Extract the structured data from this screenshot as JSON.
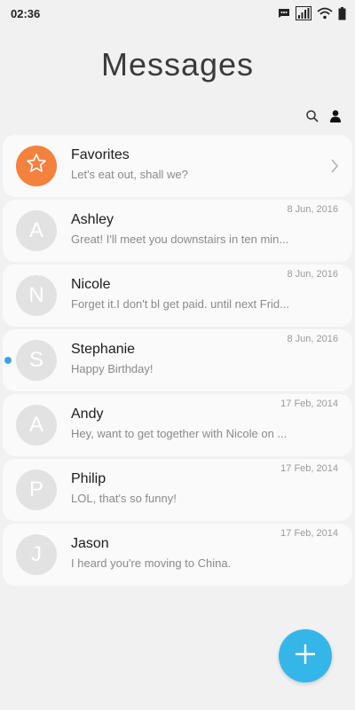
{
  "status_bar": {
    "time": "02:36",
    "icons": [
      "message-notification-icon",
      "signal-icon",
      "wifi-icon",
      "battery-icon"
    ]
  },
  "header": {
    "title": "Messages",
    "actions": [
      "search-icon",
      "contacts-icon"
    ]
  },
  "favorites": {
    "name": "Favorites",
    "snippet": "Let's eat out, shall we?",
    "icon": "star-icon",
    "accent": "#f5813f"
  },
  "threads": [
    {
      "initial": "A",
      "name": "Ashley",
      "snippet": "Great! I'll meet you downstairs in ten min...",
      "date": "8 Jun, 2016"
    },
    {
      "initial": "N",
      "name": "Nicole",
      "snippet": "Forget it.I don't bl get paid. until next Frid...",
      "date": "8 Jun, 2016"
    },
    {
      "initial": "S",
      "name": "Stephanie",
      "snippet": "Happy Birthday!",
      "date": "8 Jun, 2016",
      "unread": true
    },
    {
      "initial": "A",
      "name": "Andy",
      "snippet": "Hey, want to get together with Nicole on ...",
      "date": "17 Feb, 2014"
    },
    {
      "initial": "P",
      "name": "Philip",
      "snippet": "LOL, that's so funny!",
      "date": "17 Feb, 2014"
    },
    {
      "initial": "J",
      "name": "Jason",
      "snippet": "I heard you're moving to China.",
      "date": "17 Feb, 2014"
    }
  ],
  "fab": {
    "icon": "plus-icon",
    "color": "#34b7e8"
  },
  "colors": {
    "unread_dot": "#36a7e9",
    "avatar_bg": "#e2e2e2",
    "background": "#f1f1f1"
  }
}
